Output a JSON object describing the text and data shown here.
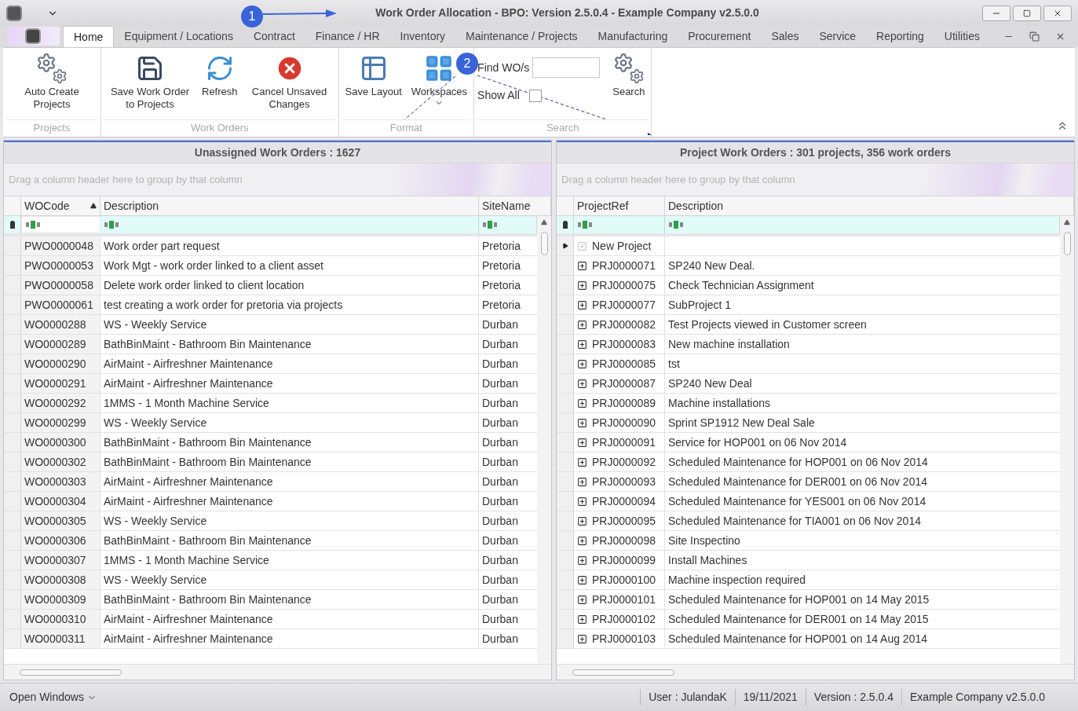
{
  "window": {
    "title": "Work Order Allocation - BPO: Version 2.5.0.4 - Example Company v2.5.0.0"
  },
  "annotations": [
    {
      "label": "1"
    },
    {
      "label": "2"
    }
  ],
  "menu_tabs": [
    {
      "label": "Home",
      "selected": true
    },
    {
      "label": "Equipment / Locations",
      "selected": false
    },
    {
      "label": "Contract",
      "selected": false
    },
    {
      "label": "Finance / HR",
      "selected": false
    },
    {
      "label": "Inventory",
      "selected": false
    },
    {
      "label": "Maintenance / Projects",
      "selected": false
    },
    {
      "label": "Manufacturing",
      "selected": false
    },
    {
      "label": "Procurement",
      "selected": false
    },
    {
      "label": "Sales",
      "selected": false
    },
    {
      "label": "Service",
      "selected": false
    },
    {
      "label": "Reporting",
      "selected": false
    },
    {
      "label": "Utilities",
      "selected": false
    }
  ],
  "ribbon_groups": [
    {
      "title": "Projects",
      "items": [
        {
          "kind": "button",
          "label": "Auto Create Projects"
        }
      ]
    },
    {
      "title": "Work Orders",
      "items": [
        {
          "kind": "button",
          "label": "Save Work Order to Projects"
        },
        {
          "kind": "button",
          "label": "Refresh"
        },
        {
          "kind": "button",
          "label": "Cancel Unsaved Changes"
        }
      ]
    },
    {
      "title": "Format",
      "items": [
        {
          "kind": "button",
          "label": "Save Layout"
        },
        {
          "kind": "dropdown",
          "label": "Workspaces"
        }
      ]
    },
    {
      "title": "Search",
      "items": [
        {
          "kind": "search_form",
          "find_label": "Find WO/s",
          "show_all_label": "Show All",
          "show_all_checked": false
        },
        {
          "kind": "button",
          "label": "Search"
        }
      ]
    }
  ],
  "left_pane": {
    "title": "Unassigned Work Orders : 1627",
    "group_hint": "Drag a column header here to group by that column",
    "columns": [
      {
        "label": "WOCode",
        "sorted": true
      },
      {
        "label": "Description",
        "sorted": false
      },
      {
        "label": "SiteName",
        "sorted": false
      }
    ],
    "rows": [
      [
        "PWO0000048",
        "Work order part request",
        "Pretoria"
      ],
      [
        "PWO0000053",
        "Work Mgt - work order linked to a client asset",
        "Pretoria"
      ],
      [
        "PWO0000058",
        "Delete work order linked to client location",
        "Pretoria"
      ],
      [
        "PWO0000061",
        "test creating a work order for pretoria via projects",
        "Pretoria"
      ],
      [
        "WO0000288",
        "WS - Weekly Service",
        "Durban"
      ],
      [
        "WO0000289",
        "BathBinMaint - Bathroom Bin Maintenance",
        "Durban"
      ],
      [
        "WO0000290",
        "AirMaint - Airfreshner Maintenance",
        "Durban"
      ],
      [
        "WO0000291",
        "AirMaint - Airfreshner Maintenance",
        "Durban"
      ],
      [
        "WO0000292",
        "1MMS - 1 Month Machine Service",
        "Durban"
      ],
      [
        "WO0000299",
        "WS - Weekly Service",
        "Durban"
      ],
      [
        "WO0000300",
        "BathBinMaint - Bathroom Bin Maintenance",
        "Durban"
      ],
      [
        "WO0000302",
        "BathBinMaint - Bathroom Bin Maintenance",
        "Durban"
      ],
      [
        "WO0000303",
        "AirMaint - Airfreshner Maintenance",
        "Durban"
      ],
      [
        "WO0000304",
        "AirMaint - Airfreshner Maintenance",
        "Durban"
      ],
      [
        "WO0000305",
        "WS - Weekly Service",
        "Durban"
      ],
      [
        "WO0000306",
        "BathBinMaint - Bathroom Bin Maintenance",
        "Durban"
      ],
      [
        "WO0000307",
        "1MMS - 1 Month Machine Service",
        "Durban"
      ],
      [
        "WO0000308",
        "WS - Weekly Service",
        "Durban"
      ],
      [
        "WO0000309",
        "BathBinMaint - Bathroom Bin Maintenance",
        "Durban"
      ],
      [
        "WO0000310",
        "AirMaint - Airfreshner Maintenance",
        "Durban"
      ],
      [
        "WO0000311",
        "AirMaint - Airfreshner Maintenance",
        "Durban"
      ]
    ]
  },
  "right_pane": {
    "title": "Project Work Orders : 301 projects, 356 work orders",
    "group_hint": "Drag a column header here to group by that column",
    "columns": [
      {
        "label": "ProjectRef"
      },
      {
        "label": "Description"
      }
    ],
    "rows": [
      {
        "ref": "New Project",
        "description": "",
        "current": true,
        "kind": "new"
      },
      {
        "ref": "PRJ0000071",
        "description": "SP240 New Deal.",
        "current": false,
        "kind": "project"
      },
      {
        "ref": "PRJ0000075",
        "description": "Check Technician Assignment",
        "current": false,
        "kind": "project"
      },
      {
        "ref": "PRJ0000077",
        "description": "SubProject 1",
        "current": false,
        "kind": "project"
      },
      {
        "ref": "PRJ0000082",
        "description": "Test Projects viewed in Customer screen",
        "current": false,
        "kind": "project"
      },
      {
        "ref": "PRJ0000083",
        "description": "New machine installation",
        "current": false,
        "kind": "project"
      },
      {
        "ref": "PRJ0000085",
        "description": "tst",
        "current": false,
        "kind": "project"
      },
      {
        "ref": "PRJ0000087",
        "description": "SP240 New Deal",
        "current": false,
        "kind": "project"
      },
      {
        "ref": "PRJ0000089",
        "description": "Machine installations",
        "current": false,
        "kind": "project"
      },
      {
        "ref": "PRJ0000090",
        "description": "Sprint SP1912 New Deal Sale",
        "current": false,
        "kind": "project"
      },
      {
        "ref": "PRJ0000091",
        "description": "Service for HOP001 on 06 Nov 2014",
        "current": false,
        "kind": "project"
      },
      {
        "ref": "PRJ0000092",
        "description": "Scheduled Maintenance for HOP001 on 06 Nov 2014",
        "current": false,
        "kind": "project"
      },
      {
        "ref": "PRJ0000093",
        "description": "Scheduled Maintenance for DER001 on 06 Nov 2014",
        "current": false,
        "kind": "project"
      },
      {
        "ref": "PRJ0000094",
        "description": "Scheduled Maintenance for YES001 on 06 Nov 2014",
        "current": false,
        "kind": "project"
      },
      {
        "ref": "PRJ0000095",
        "description": "Scheduled Maintenance for TIA001 on 06 Nov 2014",
        "current": false,
        "kind": "project"
      },
      {
        "ref": "PRJ0000098",
        "description": "Site Inspectino",
        "current": false,
        "kind": "project"
      },
      {
        "ref": "PRJ0000099",
        "description": "Install Machines",
        "current": false,
        "kind": "project"
      },
      {
        "ref": "PRJ0000100",
        "description": "Machine inspection required",
        "current": false,
        "kind": "project"
      },
      {
        "ref": "PRJ0000101",
        "description": "Scheduled Maintenance for HOP001 on 14 May 2015",
        "current": false,
        "kind": "project"
      },
      {
        "ref": "PRJ0000102",
        "description": "Scheduled Maintenance for DER001 on 14 May 2015",
        "current": false,
        "kind": "project"
      },
      {
        "ref": "PRJ0000103",
        "description": "Scheduled Maintenance for HOP001 on 14 Aug 2014",
        "current": false,
        "kind": "project"
      }
    ]
  },
  "status_bar": {
    "open_windows": "Open Windows",
    "fields": [
      "User : JulandaK",
      "19/11/2021",
      "Version : 2.5.0.4",
      "Example Company v2.5.0.0"
    ]
  }
}
